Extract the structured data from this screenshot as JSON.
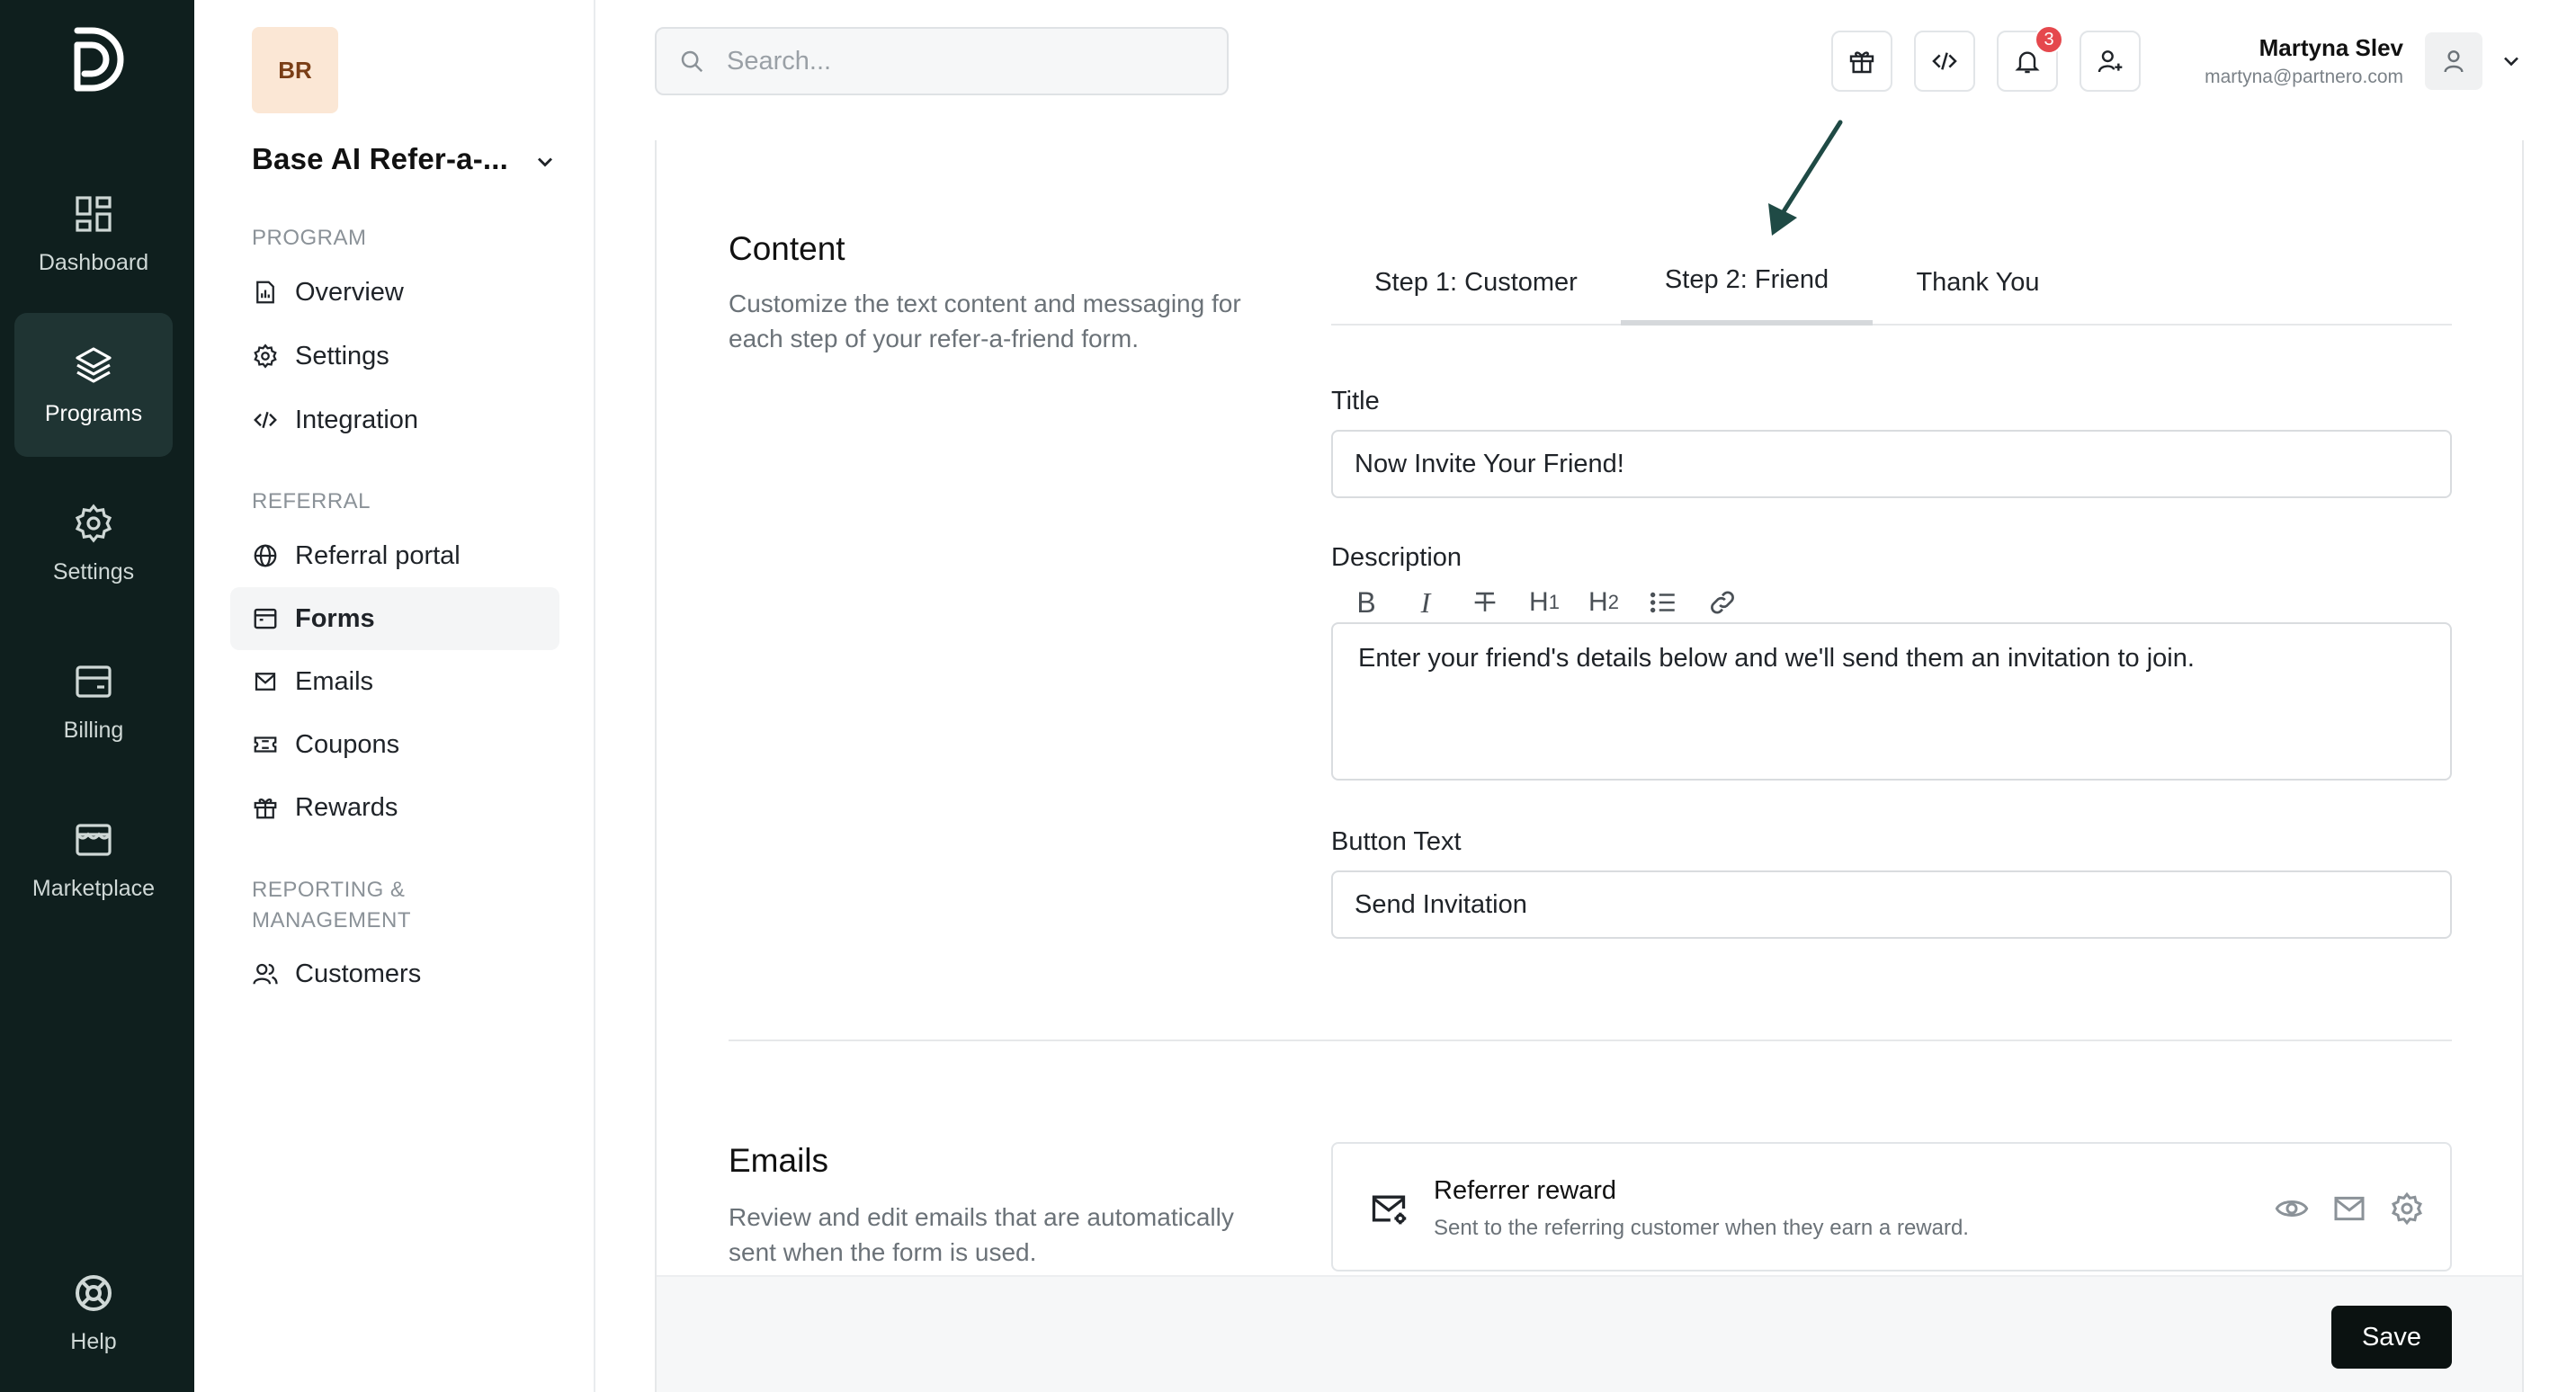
{
  "rail": {
    "items": [
      {
        "label": "Dashboard",
        "icon": "dashboard-icon"
      },
      {
        "label": "Programs",
        "icon": "layers-icon"
      },
      {
        "label": "Settings",
        "icon": "gear-icon"
      },
      {
        "label": "Billing",
        "icon": "billing-icon"
      },
      {
        "label": "Marketplace",
        "icon": "store-icon"
      }
    ],
    "help": "Help"
  },
  "sidebar": {
    "org_initials": "BR",
    "org_name": "Base AI Refer-a-...",
    "sections": {
      "program": "PROGRAM",
      "referral": "REFERRAL",
      "reporting": "REPORTING & MANAGEMENT"
    },
    "items": {
      "overview": "Overview",
      "settings": "Settings",
      "integration": "Integration",
      "referral_portal": "Referral portal",
      "forms": "Forms",
      "emails": "Emails",
      "coupons": "Coupons",
      "rewards": "Rewards",
      "customers": "Customers"
    }
  },
  "topbar": {
    "search_placeholder": "Search...",
    "notifications_count": "3",
    "user_name": "Martyna Slev",
    "user_email": "martyna@partnero.com"
  },
  "content": {
    "title": "Content",
    "description": "Customize the text content and messaging for each step of your refer-a-friend form.",
    "tabs": [
      "Step 1: Customer",
      "Step 2: Friend",
      "Thank You"
    ],
    "active_tab": "Step 2: Friend",
    "title_label": "Title",
    "title_value": "Now Invite Your Friend!",
    "description_label": "Description",
    "description_value": "Enter your friend's details below and we'll send them an invitation to join.",
    "button_text_label": "Button Text",
    "button_text_value": "Send Invitation"
  },
  "emails": {
    "title": "Emails",
    "description": "Review and edit emails that are automatically sent when the form is used.",
    "rows": [
      {
        "title": "Referrer reward",
        "subtitle": "Sent to the referring customer when they earn a reward."
      }
    ]
  },
  "footer": {
    "save_label": "Save"
  },
  "colors": {
    "rail_bg": "#0f1f1e",
    "accent_dark": "#0b1211",
    "badge": "#e5484d",
    "org_avatar_bg": "#fbe7d5",
    "annotation_arrow": "#1f4a45"
  }
}
